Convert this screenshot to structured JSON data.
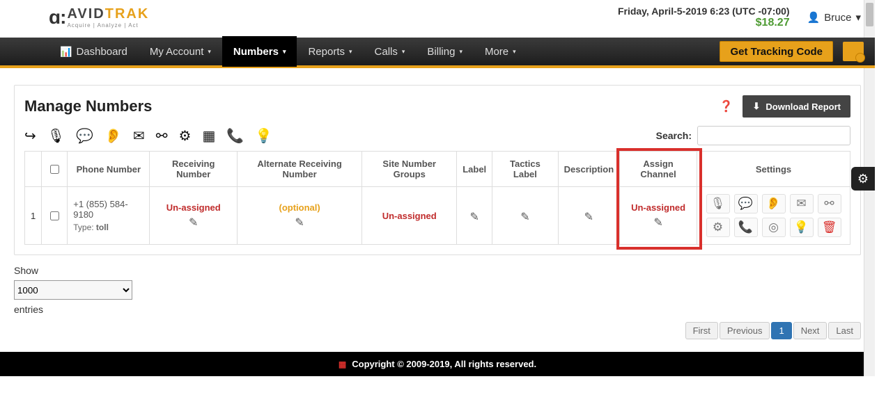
{
  "header": {
    "logo_avid": "AVID",
    "logo_trak": "TRAK",
    "logo_sub": "Acquire  |  Analyze  |  Act",
    "datetime": "Friday, April-5-2019 6:23 (UTC -07:00)",
    "balance": "$18.27",
    "user_name": "Bruce"
  },
  "nav": {
    "items": [
      "Dashboard",
      "My Account",
      "Numbers",
      "Reports",
      "Calls",
      "Billing",
      "More"
    ],
    "active_index": 2,
    "tracking_button": "Get Tracking Code"
  },
  "page": {
    "title": "Manage Numbers",
    "download_label": "Download Report",
    "search_label": "Search:",
    "search_value": ""
  },
  "columns": [
    "",
    "",
    "Phone Number",
    "Receiving Number",
    "Alternate Receiving Number",
    "Site Number Groups",
    "Label",
    "Tactics Label",
    "Description",
    "Assign Channel",
    "Settings"
  ],
  "row": {
    "index": "1",
    "phone": "+1 (855) 584-9180",
    "type_label": "Type: ",
    "type_value": "toll",
    "receiving": "Un-assigned",
    "alternate": "(optional)",
    "site_groups": "Un-assigned",
    "label": "",
    "tactics": "",
    "description": "",
    "assign_channel": "Un-assigned"
  },
  "show": {
    "label_top": "Show",
    "selected": "1000",
    "label_bottom": "entries"
  },
  "paging": {
    "first": "First",
    "prev": "Previous",
    "current": "1",
    "next": "Next",
    "last": "Last"
  },
  "footer": {
    "text": "Copyright © 2009-2019, All rights reserved."
  }
}
